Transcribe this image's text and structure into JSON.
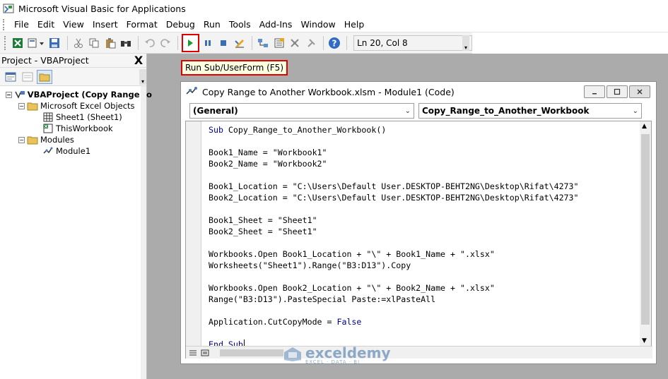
{
  "window": {
    "title": "Microsoft Visual Basic for Applications"
  },
  "menu": [
    {
      "label": "File"
    },
    {
      "label": "Edit"
    },
    {
      "label": "View"
    },
    {
      "label": "Insert"
    },
    {
      "label": "Format"
    },
    {
      "label": "Debug"
    },
    {
      "label": "Run"
    },
    {
      "label": "Tools"
    },
    {
      "label": "Add-Ins"
    },
    {
      "label": "Window"
    },
    {
      "label": "Help"
    }
  ],
  "toolbar": {
    "position": "Ln 20, Col 8"
  },
  "tooltip": {
    "text": "Run Sub/UserForm (F5)"
  },
  "project": {
    "title": "Project - VBAProject",
    "close": "X",
    "tree": {
      "root": "VBAProject (Copy Range to A",
      "excel_objects": "Microsoft Excel Objects",
      "sheet1": "Sheet1 (Sheet1)",
      "thisworkbook": "ThisWorkbook",
      "modules": "Modules",
      "module1": "Module1"
    }
  },
  "codewindow": {
    "title": "Copy Range to Another Workbook.xlsm - Module1 (Code)",
    "object_combo": "(General)",
    "proc_combo": "Copy_Range_to_Another_Workbook",
    "lines": [
      "Sub Copy_Range_to_Another_Workbook()",
      "",
      "Book1_Name = \"Workbook1\"",
      "Book2_Name = \"Workbook2\"",
      "",
      "Book1_Location = \"C:\\Users\\Default User.DESKTOP-BEHT2NG\\Desktop\\Rifat\\4273\"",
      "Book2_Location = \"C:\\Users\\Default User.DESKTOP-BEHT2NG\\Desktop\\Rifat\\4273\"",
      "",
      "Book1_Sheet = \"Sheet1\"",
      "Book2_Sheet = \"Sheet1\"",
      "",
      "Workbooks.Open Book1_Location + \"\\\" + Book1_Name + \".xlsx\"",
      "Worksheets(\"Sheet1\").Range(\"B3:D13\").Copy",
      "",
      "Workbooks.Open Book2_Location + \"\\\" + Book2_Name + \".xlsx\"",
      "Range(\"B3:D13\").PasteSpecial Paste:=xlPasteAll",
      "",
      "Application.CutCopyMode = False",
      "",
      "End Sub"
    ]
  },
  "watermark": {
    "name": "exceldemy",
    "sub": "EXCEL · DATA · BI"
  }
}
